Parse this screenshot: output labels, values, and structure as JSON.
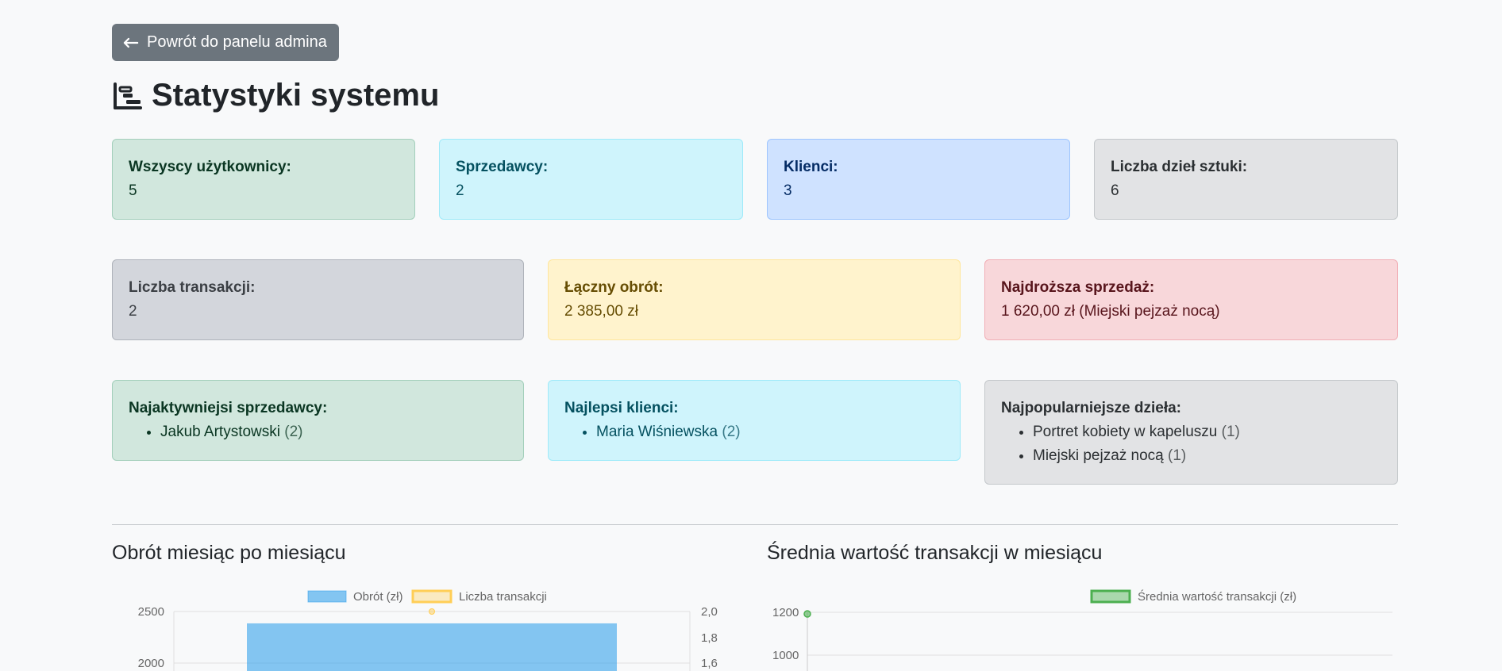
{
  "back_button": {
    "label": "Powrót do panelu admina",
    "icon": "arrow-left-icon"
  },
  "page_title": {
    "text": "Statystyki systemu",
    "icon": "bar-chart-steps-icon"
  },
  "row1": [
    {
      "label": "Wszyscy użytkownicy:",
      "value": "5"
    },
    {
      "label": "Sprzedawcy:",
      "value": "2"
    },
    {
      "label": "Klienci:",
      "value": "3"
    },
    {
      "label": "Liczba dzieł sztuki:",
      "value": "6"
    }
  ],
  "row2": [
    {
      "label": "Liczba transakcji:",
      "value": "2"
    },
    {
      "label": "Łączny obrót:",
      "value": "2 385,00 zł"
    },
    {
      "label": "Najdroższa sprzedaż:",
      "value": "1 620,00 zł (Miejski pejzaż nocą)"
    }
  ],
  "row3": [
    {
      "label": "Najaktywniejsi sprzedawcy:",
      "items": [
        {
          "name": "Jakub Artystowski",
          "count": "(2)"
        }
      ]
    },
    {
      "label": "Najlepsi klienci:",
      "items": [
        {
          "name": "Maria Wiśniewska",
          "count": "(2)"
        }
      ]
    },
    {
      "label": "Najpopularniejsze dzieła:",
      "items": [
        {
          "name": "Portret kobiety w kapeluszu",
          "count": "(1)"
        },
        {
          "name": "Miejski pejzaż nocą",
          "count": "(1)"
        }
      ]
    }
  ],
  "charts": {
    "left_title": "Obrót miesiąc po miesiącu",
    "right_title": "Średnia wartość transakcji w miesiącu"
  },
  "chart_data": [
    {
      "type": "bar",
      "title": "Obrót miesiąc po miesiącu",
      "legend": [
        "Obrót (zł)",
        "Liczba transakcji"
      ],
      "legend_placement": "top",
      "series": [
        {
          "name": "Obrót (zł)",
          "type": "bar",
          "values": [
            2385
          ],
          "color": "#36a2eb"
        },
        {
          "name": "Liczba transakcji",
          "type": "line",
          "axis": "right",
          "values": [
            2
          ],
          "color": "#ffce56"
        }
      ],
      "y_left_ticks": [
        "2500",
        "2000"
      ],
      "y_right_ticks": [
        "2,0",
        "1,8",
        "1,6"
      ],
      "y_left_range": [
        0,
        2500
      ],
      "y_right_range": [
        0,
        2.0
      ],
      "grid": true
    },
    {
      "type": "line",
      "title": "Średnia wartość transakcji w miesiącu",
      "legend": [
        "Średnia wartość transakcji (zł)"
      ],
      "legend_placement": "top",
      "series": [
        {
          "name": "Średnia wartość transakcji (zł)",
          "values": [
            1192.5
          ],
          "color": "#4caf50"
        }
      ],
      "y_ticks": [
        "1200",
        "1000"
      ],
      "y_range": [
        0,
        1200
      ],
      "grid": true
    }
  ]
}
